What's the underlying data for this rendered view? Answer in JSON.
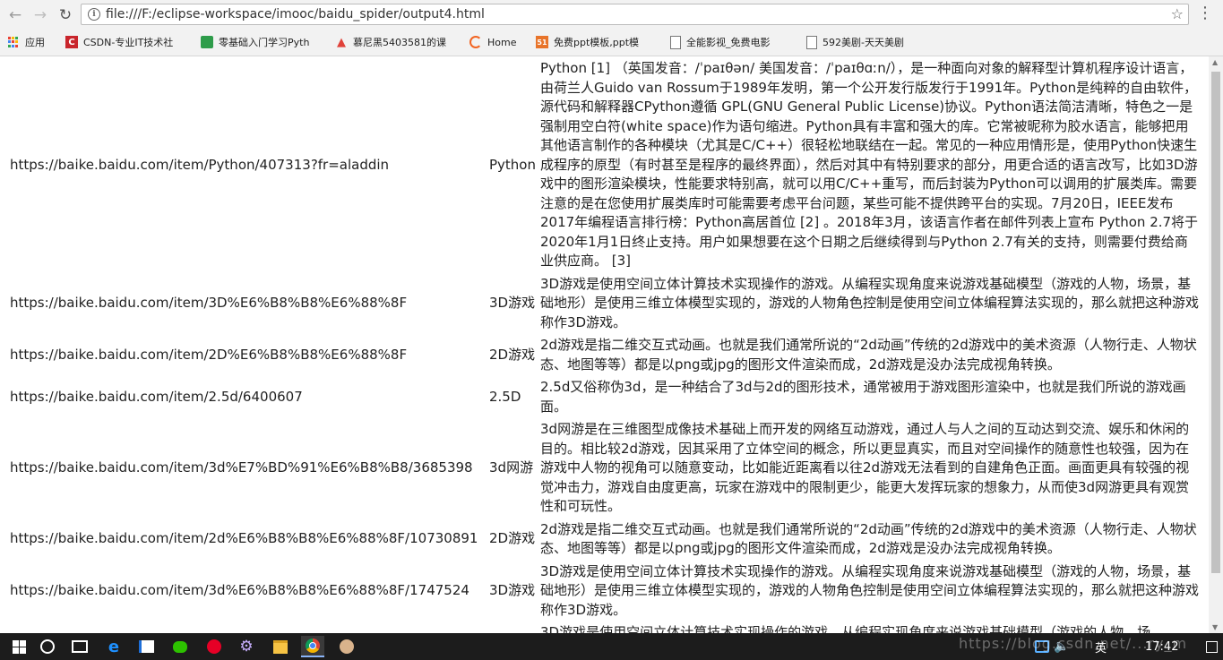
{
  "browser": {
    "url": "file:///F:/eclipse-workspace/imooc/baidu_spider/output4.html",
    "bookmarks": [
      {
        "label": "应用",
        "icon": "apps-grid-icon"
      },
      {
        "label": "CSDN-专业IT技术社",
        "icon": "csdn-icon",
        "color": "#c9252c"
      },
      {
        "label": "零基础入门学习Pyth",
        "icon": "bookmark-green-icon",
        "color": "#2e9c4a"
      },
      {
        "label": "慕尼黑5403581的课",
        "icon": "flame-icon",
        "color": "#e0423a"
      },
      {
        "label": "Home",
        "icon": "home-ring-icon",
        "color": "#f26522"
      },
      {
        "label": "免费ppt模板,ppt模",
        "icon": "ppt-icon",
        "color": "#e8742a"
      },
      {
        "label": "全能影视_免费电影",
        "icon": "page-icon"
      },
      {
        "label": "592美剧-天天美剧",
        "icon": "page-icon"
      }
    ]
  },
  "table": {
    "rows": [
      {
        "url": "https://baike.baidu.com/item/Python/407313?fr=aladdin",
        "name": "Python",
        "summary": "Python [1] （英国发音：/ˈpaɪθən/ 美国发音：/ˈpaɪθɑːn/），是一种面向对象的解释型计算机程序设计语言，由荷兰人Guido van Rossum于1989年发明，第一个公开发行版发行于1991年。Python是纯粹的自由软件， 源代码和解释器CPython遵循 GPL(GNU General Public License)协议。Python语法简洁清晰，特色之一是强制用空白符(white space)作为语句缩进。Python具有丰富和强大的库。它常被昵称为胶水语言，能够把用其他语言制作的各种模块（尤其是C/C++）很轻松地联结在一起。常见的一种应用情形是，使用Python快速生成程序的原型（有时甚至是程序的最终界面），然后对其中有特别要求的部分，用更合适的语言改写，比如3D游戏中的图形渲染模块，性能要求特别高，就可以用C/C++重写，而后封装为Python可以调用的扩展类库。需要注意的是在您使用扩展类库时可能需要考虑平台问题，某些可能不提供跨平台的实现。7月20日，IEEE发布2017年编程语言排行榜：Python高居首位 [2] 。2018年3月，该语言作者在邮件列表上宣布 Python 2.7将于2020年1月1日终止支持。用户如果想要在这个日期之后继续得到与Python 2.7有关的支持，则需要付费给商业供应商。 [3]"
      },
      {
        "url": "https://baike.baidu.com/item/3D%E6%B8%B8%E6%88%8F",
        "name": "3D游戏",
        "summary": "3D游戏是使用空间立体计算技术实现操作的游戏。从编程实现角度来说游戏基础模型（游戏的人物，场景，基础地形）是使用三维立体模型实现的，游戏的人物角色控制是使用空间立体编程算法实现的，那么就把这种游戏称作3D游戏。"
      },
      {
        "url": "https://baike.baidu.com/item/2D%E6%B8%B8%E6%88%8F",
        "name": "2D游戏",
        "summary": "2d游戏是指二维交互式动画。也就是我们通常所说的“2d动画”传统的2d游戏中的美术资源（人物行走、人物状态、地图等等）都是以png或jpg的图形文件渲染而成，2d游戏是没办法完成视角转换。"
      },
      {
        "url": "https://baike.baidu.com/item/2.5d/6400607",
        "name": "2.5D",
        "summary": "2.5d又俗称伪3d，是一种结合了3d与2d的图形技术，通常被用于游戏图形渲染中，也就是我们所说的游戏画面。"
      },
      {
        "url": "https://baike.baidu.com/item/3d%E7%BD%91%E6%B8%B8/3685398",
        "name": "3d网游",
        "summary": "3d网游是在三维图型成像技术基础上而开发的网络互动游戏，通过人与人之间的互动达到交流、娱乐和休闲的目的。相比较2d游戏，因其采用了立体空间的概念，所以更显真实，而且对空间操作的随意性也较强，因为在游戏中人物的视角可以随意变动，比如能近距离看以往2d游戏无法看到的自建角色正面。画面更具有较强的视觉冲击力，游戏自由度更高，玩家在游戏中的限制更少，能更大发挥玩家的想象力，从而使3d网游更具有观赏性和可玩性。"
      },
      {
        "url": "https://baike.baidu.com/item/2d%E6%B8%B8%E6%88%8F/10730891",
        "name": "2D游戏",
        "summary": "2d游戏是指二维交互式动画。也就是我们通常所说的“2d动画”传统的2d游戏中的美术资源（人物行走、人物状态、地图等等）都是以png或jpg的图形文件渲染而成，2d游戏是没办法完成视角转换。"
      },
      {
        "url": "https://baike.baidu.com/item/3d%E6%B8%B8%E6%88%8F/1747524",
        "name": "3D游戏",
        "summary": "3D游戏是使用空间立体计算技术实现操作的游戏。从编程实现角度来说游戏基础模型（游戏的人物，场景，基础地形）是使用三维立体模型实现的，游戏的人物角色控制是使用空间立体编程算法实现的，那么就把这种游戏称作3D游戏。"
      },
      {
        "url": "",
        "name": "",
        "summary": "3D游戏是使用空间立体计算技术实现操作的游戏。从编程实现角度来说游戏基础模型（游戏的人物，场"
      }
    ]
  },
  "taskbar": {
    "ime": "英",
    "clock": "17:42",
    "watermark": "https://blog.csdn.net/...ry_m"
  }
}
